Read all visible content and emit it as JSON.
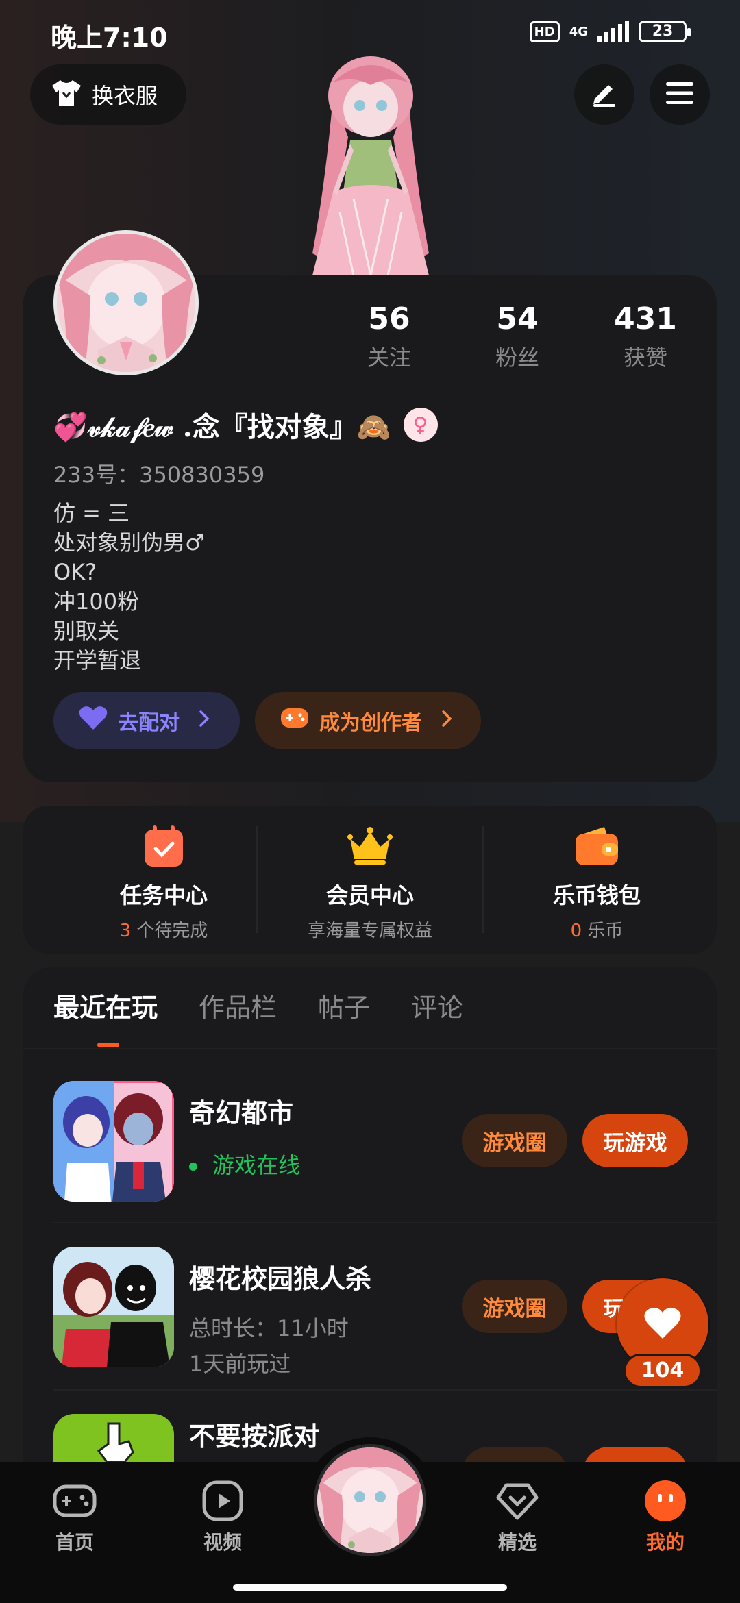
{
  "status_bar": {
    "time": "晚上7:10",
    "hd": "HD",
    "network": "4G",
    "battery": "23"
  },
  "header": {
    "outfit_label": "换衣服"
  },
  "profile": {
    "nickname": "💞𝓋𝓀𝒶𝒻𝑒𝓌 .念『找对象』🙈",
    "gender_symbol": "♀",
    "uid_text": "233号：350830359",
    "bio": "仿 = 三\n处对象别伪男♂\nOK?\n冲100粉\n别取关\n开学暂退",
    "stats": [
      {
        "value": "56",
        "label": "关注"
      },
      {
        "value": "54",
        "label": "粉丝"
      },
      {
        "value": "431",
        "label": "获赞"
      }
    ],
    "match_label": "去配对",
    "creator_label": "成为创作者"
  },
  "services": [
    {
      "title": "任务中心",
      "highlight": "3",
      "sub": " 个待完成"
    },
    {
      "title": "会员中心",
      "highlight": "",
      "sub": "享海量专属权益"
    },
    {
      "title": "乐币钱包",
      "highlight": "0",
      "sub": " 乐币"
    }
  ],
  "tabs": [
    "最近在玩",
    "作品栏",
    "帖子",
    "评论"
  ],
  "games": [
    {
      "title": "奇幻都市",
      "line1": "游戏在线",
      "line2": "",
      "circle_btn": "游戏圈",
      "play_btn": "玩游戏"
    },
    {
      "title": "樱花校园狼人杀",
      "line1": "总时长：11小时",
      "line2": "1天前玩过",
      "circle_btn": "游戏圈",
      "play_btn": "玩游戏"
    },
    {
      "title": "不要按派对",
      "line1": "",
      "line2": "",
      "circle_btn": "游戏圈",
      "play_btn": "玩游戏"
    }
  ],
  "floating_like": {
    "count": "104"
  },
  "bottom_nav": [
    {
      "label": "首页"
    },
    {
      "label": "视频"
    },
    {
      "label": "精选"
    },
    {
      "label": "我的"
    }
  ],
  "colors": {
    "accent": "#ff6a2d",
    "play": "#d6450e",
    "online": "#21c35b",
    "match": "#8c84ff"
  }
}
